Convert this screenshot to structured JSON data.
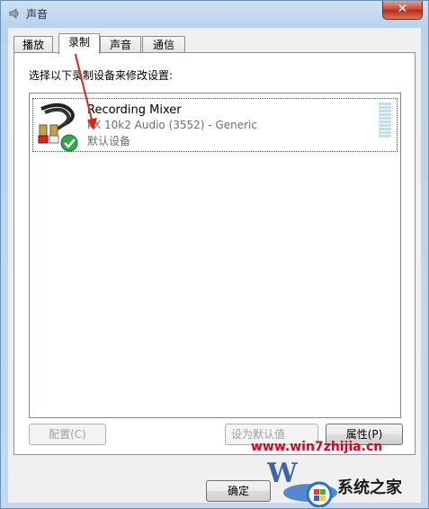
{
  "window": {
    "title": "声音",
    "close_label": "✕"
  },
  "tabs": [
    {
      "label": "播放",
      "active": false
    },
    {
      "label": "录制",
      "active": true
    },
    {
      "label": "声音",
      "active": false
    },
    {
      "label": "通信",
      "active": false
    }
  ],
  "panel": {
    "instruction": "选择以下录制设备来修改设置:",
    "devices": [
      {
        "name": "Recording Mixer",
        "description": "kX 10k2 Audio (3552) - Generic",
        "status": "默认设备",
        "icon": "rca-cable-icon",
        "default_badge": "checkmark-icon"
      }
    ]
  },
  "buttons": {
    "configure": "配置(C)",
    "set_default": "设为默认值",
    "properties": "属性(P)",
    "ok": "确定"
  },
  "watermark": {
    "url": "www.win7zhijia.cn",
    "brand": "系统之家"
  },
  "colors": {
    "annotation_arrow": "#d9261c",
    "title_accent": "#1b2f4a"
  }
}
